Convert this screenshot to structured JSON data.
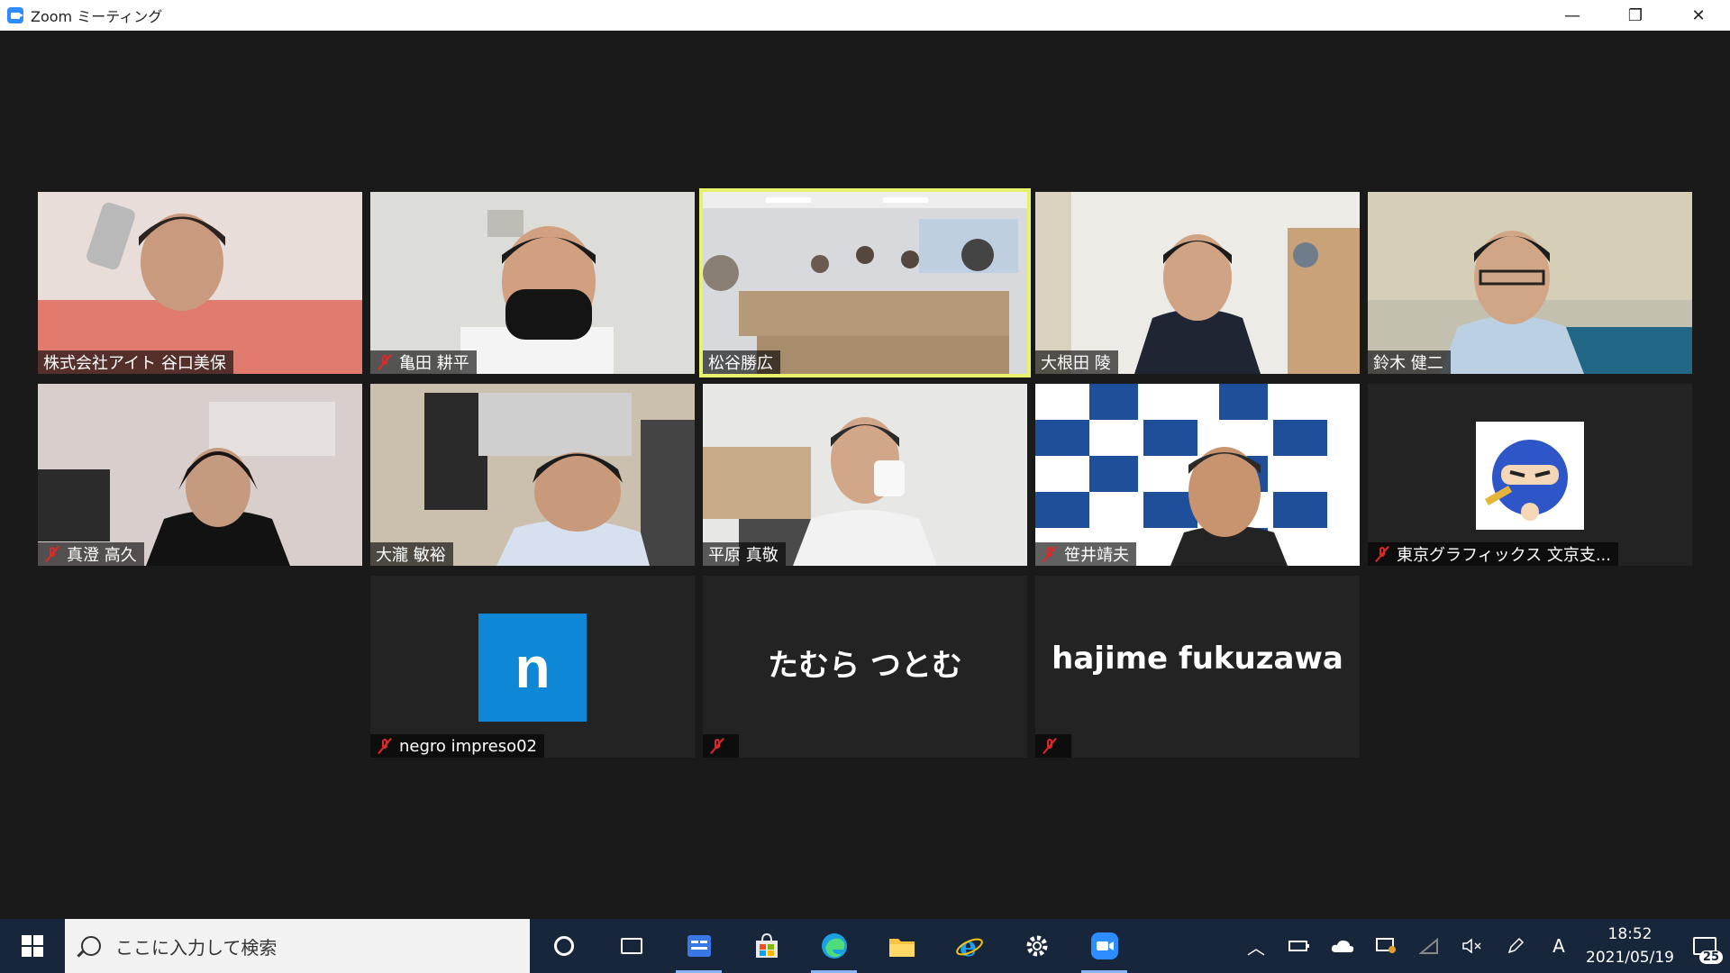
{
  "window": {
    "title": "Zoom ミーティング",
    "controls": {
      "minimize": "—",
      "restore": "❐",
      "close": "✕"
    }
  },
  "participants": [
    {
      "name": "株式会社アイト 谷口美保",
      "muted": false,
      "video": true,
      "active": false
    },
    {
      "name": "亀田 耕平",
      "muted": true,
      "video": true,
      "active": false
    },
    {
      "name": "松谷勝広",
      "muted": false,
      "video": true,
      "active": true
    },
    {
      "name": "大根田 陵",
      "muted": false,
      "video": true,
      "active": false
    },
    {
      "name": "鈴木 健二",
      "muted": false,
      "video": true,
      "active": false
    },
    {
      "name": "真澄 高久",
      "muted": true,
      "video": true,
      "active": false
    },
    {
      "name": "大瀧 敏裕",
      "muted": false,
      "video": true,
      "active": false
    },
    {
      "name": "平原 真敬",
      "muted": false,
      "video": true,
      "active": false
    },
    {
      "name": "笹井靖夫",
      "muted": true,
      "video": true,
      "active": false
    },
    {
      "name": "東京グラフィックス 文京支...",
      "muted": true,
      "video": false,
      "avatar": "ninja-icon",
      "active": false
    },
    {
      "name": "negro impreso02",
      "muted": true,
      "video": false,
      "avatar_letter": "n",
      "active": false
    },
    {
      "name": "",
      "display_name": "たむら つとむ",
      "muted": true,
      "video": false,
      "active": false
    },
    {
      "name": "",
      "display_name": "hajime fukuzawa",
      "muted": true,
      "video": false,
      "active": false
    }
  ],
  "taskbar": {
    "search_placeholder": "ここに入力して検索",
    "pinned": [
      "cortana-icon",
      "task-view-icon",
      "control-panel-icon",
      "store-icon",
      "edge-icon",
      "file-explorer-icon",
      "internet-explorer-icon",
      "settings-icon",
      "zoom-icon"
    ],
    "ime": "A",
    "time": "18:52",
    "date": "2021/05/19",
    "notification_count": "25"
  },
  "colors": {
    "background": "#1a1a1a",
    "active_speaker": "#e6f26a",
    "muted": "#e02828",
    "avatar_blue": "#0e87d6",
    "taskbar": "#17263a"
  }
}
